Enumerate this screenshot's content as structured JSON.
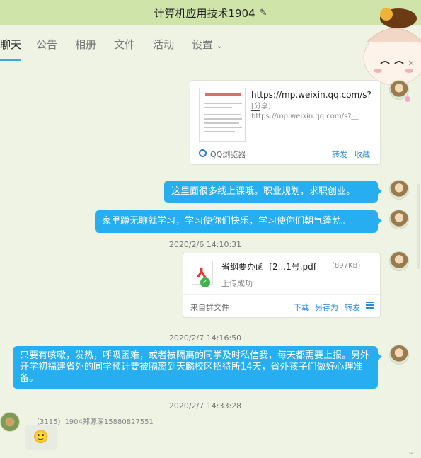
{
  "title": "计算机应用技术1904",
  "tabs": [
    "聊天",
    "公告",
    "相册",
    "文件",
    "活动",
    "设置"
  ],
  "messages": {
    "link": {
      "url": "https://mp.weixin.qq.com/s?__",
      "sub": "[分享] https://mp.weixin.qq.com/s?__",
      "browser": "QQ浏览器",
      "forward": "转发",
      "collect": "收藏",
      "thumb_title": "福建省教育厅办公室文件"
    },
    "bubble1": "这里面很多线上课哦。职业规划，求职创业。",
    "bubble2": "家里蹲无聊就学习，学习使你们快乐，学习使你们朝气蓬勃。",
    "time1": "2020/2/6 14:10:31",
    "file": {
      "name": "省纲要办函〔2...1号.pdf",
      "size": "(897KB)",
      "status": "上传成功",
      "source": "来自群文件",
      "download": "下载",
      "save_as": "另存为",
      "forward": "转发"
    },
    "time2": "2020/2/7 14:16:50",
    "bubble3": "只要有咳嗽，发热，呼吸困难，或者被隔离的同学及时私信我，每天都需要上报。另外开学初福建省外的同学预计要被隔离到天麟校区招待所14天，省外孩子们做好心理准备。",
    "time3": "2020/2/7 14:33:28",
    "sender": "（3115）1904郑源深15880827551",
    "emoji": "🙂"
  },
  "colors": {
    "bubble": "#27aef0",
    "titlebar": "#cfe4a8",
    "background": "#eef3e4"
  }
}
